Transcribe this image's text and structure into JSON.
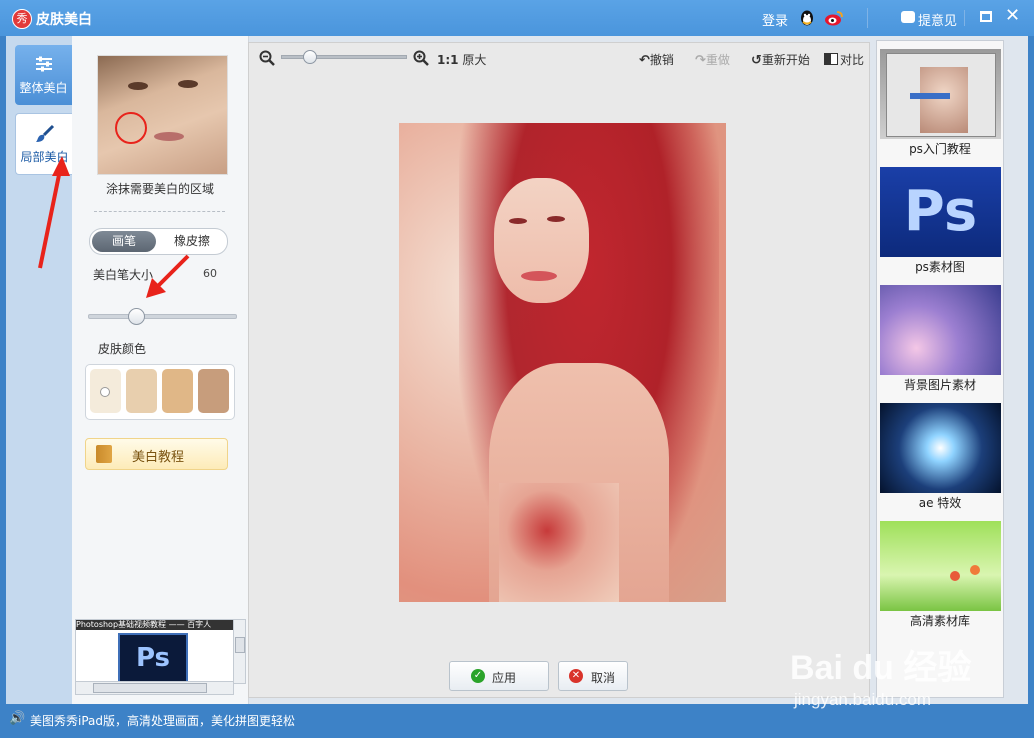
{
  "titlebar": {
    "logo_glyph": "秀",
    "title": "皮肤美白",
    "login": "登录",
    "feedback": "提意见",
    "qq_icon": "qq-penguin-icon",
    "weibo_icon": "weibo-icon"
  },
  "left_tabs": [
    {
      "label": "整体美白",
      "icon": "sliders-icon"
    },
    {
      "label": "局部美白",
      "icon": "brush-icon"
    }
  ],
  "tool_panel": {
    "hint": "涂抹需要美白的区域",
    "mode_brush": "画笔",
    "mode_eraser": "橡皮擦",
    "brush_size_label": "美白笔大小",
    "brush_size_value": "60",
    "brush_size_fraction": 0.3,
    "skin_color_label": "皮肤颜色",
    "skin_colors": [
      "#f4ebdb",
      "#e8cfae",
      "#e0b787",
      "#c79d7c"
    ],
    "tutorial_button": "美白教程",
    "ad_banner_text": "Photoshop基础视频教程 —— 百字人",
    "ad_logo": "Ps"
  },
  "canvas_toolbar": {
    "zoom_fraction": 0.2,
    "ratio_prefix": "1:1",
    "ratio_label": "原大",
    "undo": "撤销",
    "redo": "重做",
    "restart": "重新开始",
    "compare": "对比"
  },
  "canvas_buttons": {
    "apply": "应用",
    "cancel": "取消"
  },
  "right_ads": [
    {
      "caption": "ps入门教程"
    },
    {
      "caption": "ps素材图",
      "logo": "Ps"
    },
    {
      "caption": "背景图片素材"
    },
    {
      "caption": "ae 特效"
    },
    {
      "caption": "高清素材库"
    }
  ],
  "statusbar": {
    "text": "美图秀秀iPad版，高清处理画面，美化拼图更轻松"
  },
  "watermark": {
    "brand": "Bai du 经验",
    "url": "jingyan.baidu.com"
  },
  "colors": {
    "titlebar": "#4a95dc",
    "accent_red": "#e8231b",
    "apply_icon_green": "#2aa32a",
    "cancel_icon_red": "#d9342b"
  }
}
